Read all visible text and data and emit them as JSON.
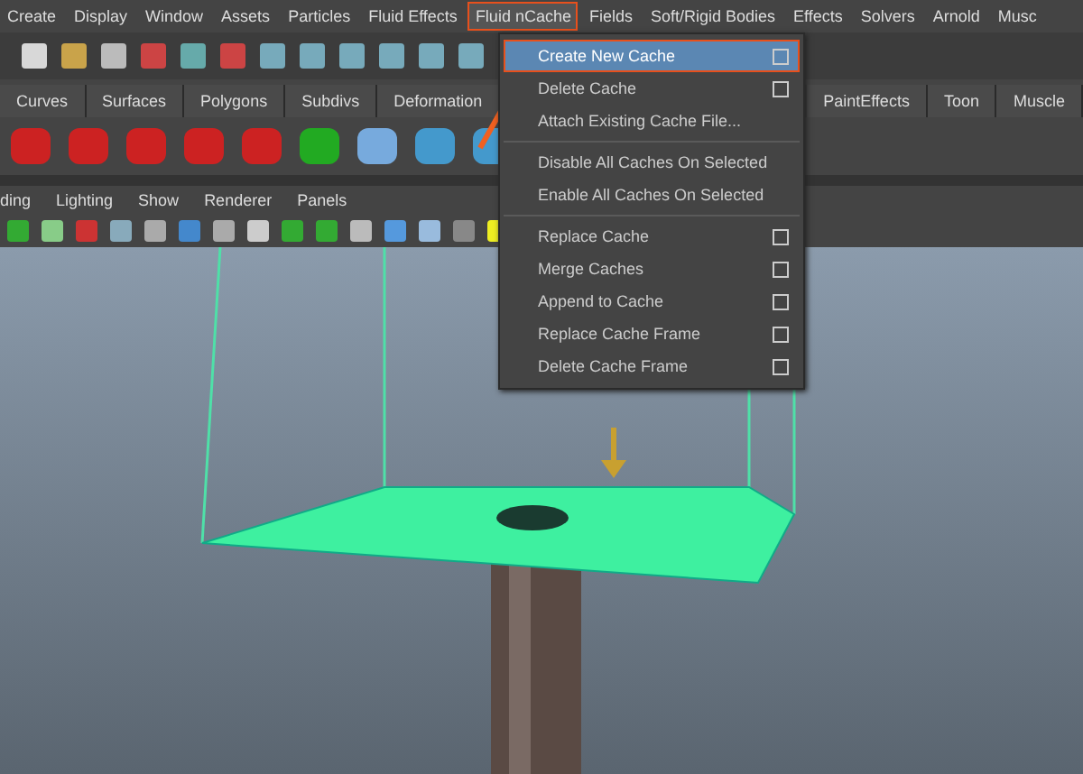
{
  "menubar": [
    {
      "label": "Create",
      "selected": false
    },
    {
      "label": "Display",
      "selected": false
    },
    {
      "label": "Window",
      "selected": false
    },
    {
      "label": "Assets",
      "selected": false
    },
    {
      "label": "Particles",
      "selected": false
    },
    {
      "label": "Fluid Effects",
      "selected": false
    },
    {
      "label": "Fluid nCache",
      "selected": true
    },
    {
      "label": "Fields",
      "selected": false
    },
    {
      "label": "Soft/Rigid Bodies",
      "selected": false
    },
    {
      "label": "Effects",
      "selected": false
    },
    {
      "label": "Solvers",
      "selected": false
    },
    {
      "label": "Arnold",
      "selected": false
    },
    {
      "label": "Musc",
      "selected": false
    }
  ],
  "shelf_tabs_left": [
    "Curves",
    "Surfaces",
    "Polygons",
    "Subdivs",
    "Deformation"
  ],
  "shelf_tabs_right": [
    "PaintEffects",
    "Toon",
    "Muscle"
  ],
  "panel_menu": [
    "ding",
    "Lighting",
    "Show",
    "Renderer",
    "Panels"
  ],
  "dropdown": {
    "groups": [
      [
        {
          "label": "Create New Cache",
          "option_box": true,
          "selected": true
        },
        {
          "label": "Delete Cache",
          "option_box": true,
          "selected": false
        },
        {
          "label": "Attach Existing Cache File...",
          "option_box": false,
          "selected": false
        }
      ],
      [
        {
          "label": "Disable All Caches On Selected",
          "option_box": false,
          "selected": false
        },
        {
          "label": "Enable All Caches On Selected",
          "option_box": false,
          "selected": false
        }
      ],
      [
        {
          "label": "Replace Cache",
          "option_box": true,
          "selected": false
        },
        {
          "label": "Merge Caches",
          "option_box": true,
          "selected": false
        },
        {
          "label": "Append to Cache",
          "option_box": true,
          "selected": false
        },
        {
          "label": "Replace Cache Frame",
          "option_box": true,
          "selected": false
        },
        {
          "label": "Delete Cache Frame",
          "option_box": true,
          "selected": false
        }
      ]
    ]
  }
}
